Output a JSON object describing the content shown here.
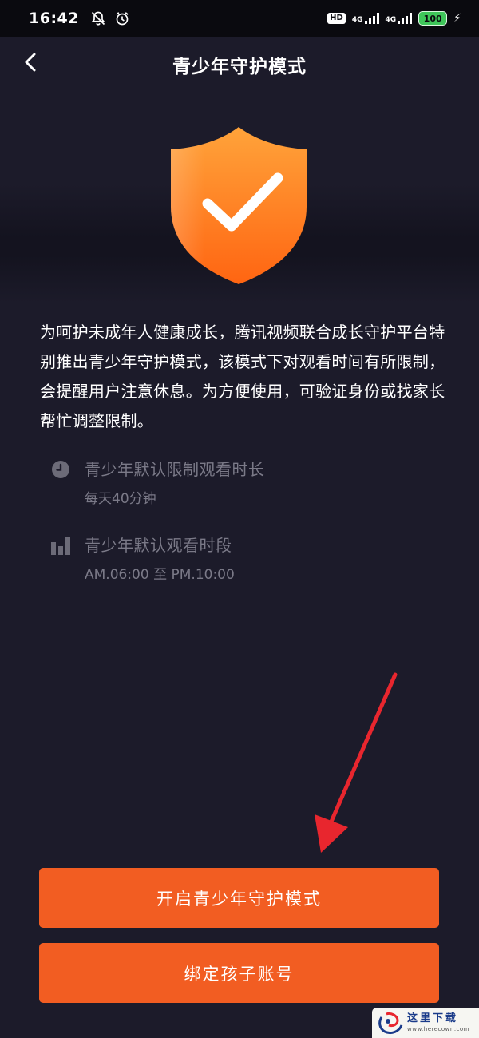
{
  "status_bar": {
    "time": "16:42",
    "hd": "HD",
    "net1": "4G",
    "net2": "4G",
    "battery": "100"
  },
  "header": {
    "title": "青少年守护模式"
  },
  "description": "为呵护未成年人健康成长，腾讯视频联合成长守护平台特别推出青少年守护模式，该模式下对观看时间有所限制，会提醒用户注意休息。为方便使用，可验证身份或找家长帮忙调整限制。",
  "info": [
    {
      "icon": "clock-icon",
      "title": "青少年默认限制观看时长",
      "sub": "每天40分钟"
    },
    {
      "icon": "bar-chart-icon",
      "title": "青少年默认观看时段",
      "sub": "AM.06:00 至 PM.10:00"
    }
  ],
  "buttons": {
    "enable": "开启青少年守护模式",
    "bind": "绑定孩子账号"
  },
  "watermark": {
    "cn": "这里下载",
    "url": "www.herecown.com"
  },
  "colors": {
    "background": "#1c1b2a",
    "accent": "#f25d22",
    "shield_top": "#ffa33a",
    "shield_bottom": "#ff6a12",
    "muted_text": "#7b7a88",
    "arrow": "#e8262e"
  }
}
